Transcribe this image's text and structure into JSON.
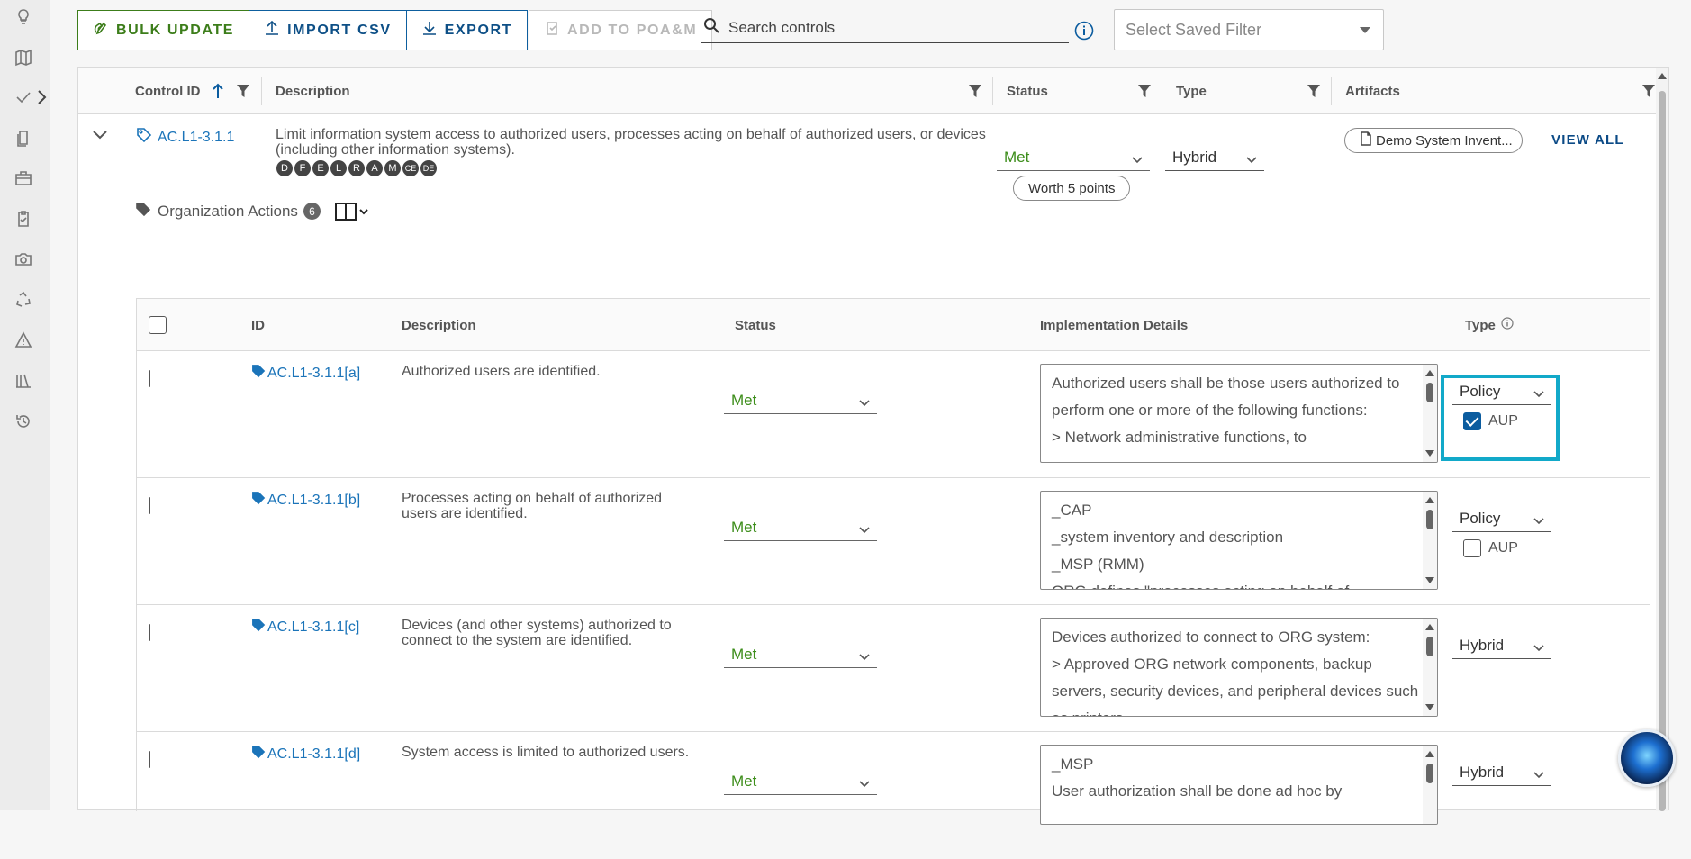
{
  "toolbar": {
    "bulk_update": "BULK UPDATE",
    "import_csv": "IMPORT CSV",
    "export": "EXPORT",
    "add_to_poam": "ADD TO POA&M"
  },
  "search": {
    "placeholder": "Search controls"
  },
  "saved_filter": {
    "placeholder": "Select Saved Filter"
  },
  "grid": {
    "headers": {
      "control_id": "Control ID",
      "description": "Description",
      "status": "Status",
      "type": "Type",
      "artifacts": "Artifacts"
    },
    "control": {
      "id": "AC.L1-3.1.1",
      "description": "Limit information system access to authorized users, processes acting on behalf of authorized users, or devices (including other information systems).",
      "badges": [
        "D",
        "F",
        "E",
        "L",
        "R",
        "A",
        "M",
        "CE",
        "DE"
      ],
      "status": "Met",
      "worth": "Worth 5 points",
      "type": "Hybrid",
      "artifact": "Demo System Invent...",
      "view_all": "VIEW ALL"
    }
  },
  "org_actions": {
    "label": "Organization Actions",
    "count": "6"
  },
  "subgrid": {
    "headers": {
      "id": "ID",
      "description": "Description",
      "status": "Status",
      "impl": "Implementation Details",
      "type": "Type"
    },
    "rows": [
      {
        "id": "AC.L1-3.1.1[a]",
        "description": "Authorized users are identified.",
        "status": "Met",
        "impl": "Authorized users shall be those users authorized to perform one or more of the following functions:\n> Network administrative functions, to",
        "type": "Policy",
        "aup": "AUP",
        "aup_checked": true
      },
      {
        "id": "AC.L1-3.1.1[b]",
        "description": "Processes acting on behalf of authorized users are identified.",
        "status": "Met",
        "impl": "_CAP\n_system inventory and description\n_MSP (RMM)\nORG defines \"processes acting on behalf of",
        "type": "Policy",
        "aup": "AUP",
        "aup_checked": false
      },
      {
        "id": "AC.L1-3.1.1[c]",
        "description": "Devices (and other systems) authorized to connect to the system are identified.",
        "status": "Met",
        "impl": "Devices authorized to connect to ORG system:\n> Approved ORG network components, backup servers, security devices, and peripheral devices such as printers",
        "type": "Hybrid"
      },
      {
        "id": "AC.L1-3.1.1[d]",
        "description": "System access is limited to authorized users.",
        "status": "Met",
        "impl": "_MSP\nUser authorization shall be done ad hoc by",
        "type": "Hybrid"
      }
    ]
  },
  "colors": {
    "accent_blue": "#0b4a86",
    "link_blue": "#1b74b9",
    "met_green": "#3c8d1a",
    "highlight_cyan": "#12a9c9"
  }
}
